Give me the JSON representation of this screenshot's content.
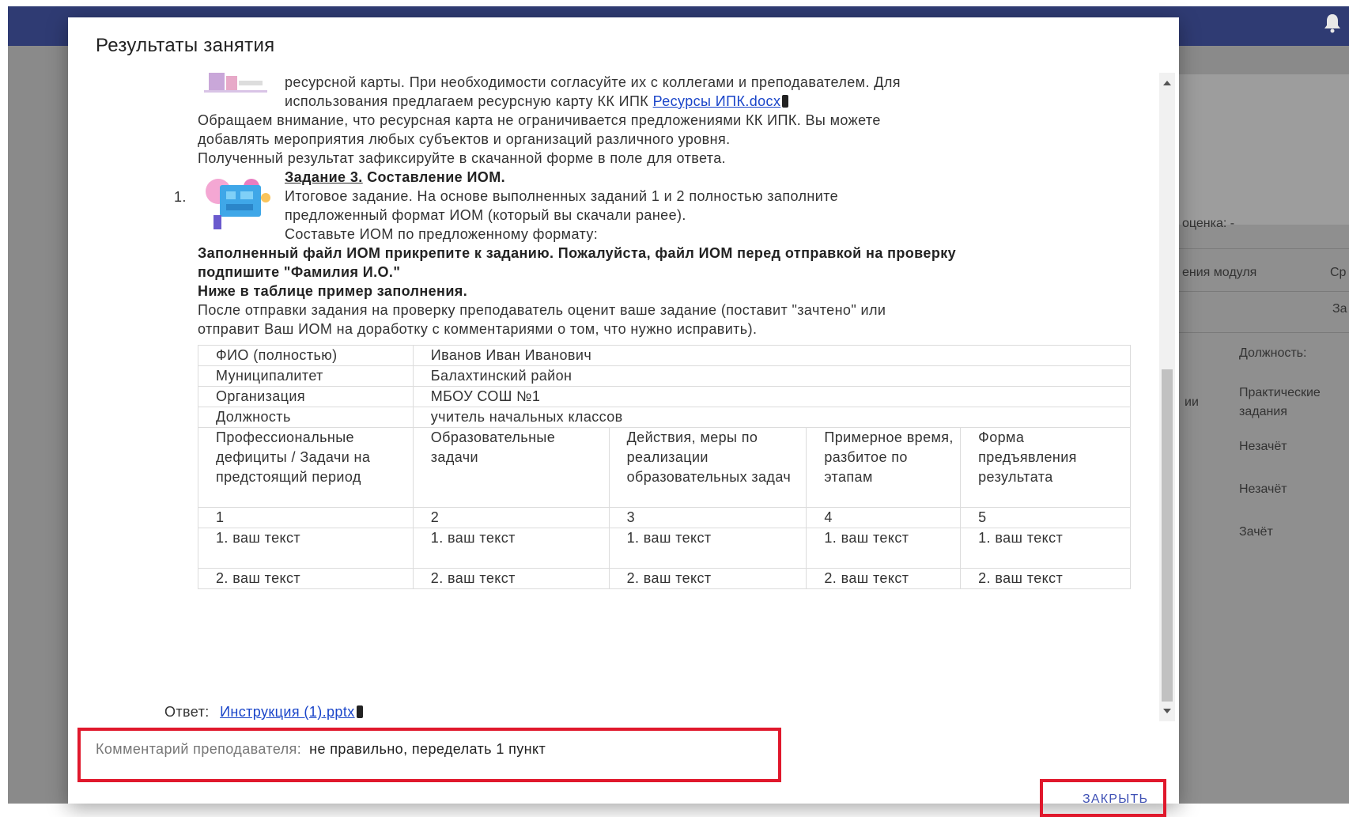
{
  "modal": {
    "title": "Результаты занятия",
    "content": {
      "top_line_1": "ресурсной карты. При необходимости согласуйте их с коллегами и преподавателем. Для",
      "top_line_2_text": "использования предлагаем ресурсную карту КК ИПК ",
      "resource_link": "Ресурсы ИПК.docx",
      "notice_1": "Обращаем внимание, что ресурсная карта не ограничивается предложениями КК ИПК. Вы можете",
      "notice_2": "добавлять мероприятия любых субъектов и организаций различного уровня.",
      "notice_3": "Полученный результат зафиксируйте в скачанной форме в поле для ответа.",
      "list_number": "1.",
      "task_title_underlined": "Задание 3.",
      "task_title_rest": " Составление ИОМ.",
      "task_line_1": "Итоговое задание. На основе выполненных заданий 1 и 2 полностью заполните",
      "task_line_2": "предложенный формат ИОМ (который вы скачали ранее).",
      "task_line_3": "Составьте ИОМ по предложенному формату:",
      "bold_1": "Заполненный файл ИОМ прикрепите к заданию. Пожалуйста, файл ИОМ перед отправкой на проверку",
      "bold_2": "подпишите \"Фамилия И.О.\"",
      "bold_3": "Ниже в таблице пример заполнения.",
      "after_1": "После отправки задания на проверку преподаватель оценит ваше задание (поставит \"зачтено\" или",
      "after_2": "отправит Ваш ИОМ на доработку с комментариями о том, что нужно исправить)."
    },
    "table": {
      "info_rows": [
        [
          "ФИО (полностью)",
          "Иванов Иван Иванович"
        ],
        [
          "Муниципалитет",
          "Балахтинский район"
        ],
        [
          "Организация",
          "МБОУ СОШ №1"
        ],
        [
          "Должность",
          "учитель начальных классов"
        ]
      ],
      "headers": [
        "Профессиональные дефициты / Задачи на предстоящий период",
        "Образовательные задачи",
        "Действия, меры по реализации образовательных задач",
        "Примерное время, разбитое по этапам",
        "Форма предъявления результата"
      ],
      "numbers": [
        "1",
        "2",
        "3",
        "4",
        "5"
      ],
      "row1": [
        "1. ваш текст",
        "1. ваш текст",
        "1. ваш текст",
        "1. ваш текст",
        "1. ваш текст"
      ],
      "row2": [
        "2. ваш текст",
        "2. ваш текст",
        "2. ваш текст",
        "2. ваш текст",
        "2. ваш текст"
      ]
    },
    "answer": {
      "label": "Ответ:",
      "file": "Инструкция (1).pptx"
    },
    "comment": {
      "label": "Комментарий преподавателя:",
      "text": "не правильно, переделать 1 пункт"
    },
    "close_label": "ЗАКРЫТЬ"
  },
  "background": {
    "grade_label": "оценка:  -",
    "col_module": "ения модуля",
    "col_cr": "Ср",
    "col_za": "За",
    "position_label": "Должность:",
    "practical_1": "Практические",
    "practical_2": "задания",
    "fragment_ii": "ии",
    "status_1": "Незачёт",
    "status_2": "Незачёт",
    "status_3": "Зачёт"
  },
  "colors": {
    "topbar": "#2f3b73",
    "highlight": "#e0182c",
    "link": "#1a45c9",
    "close_button": "#3f51b5"
  },
  "icons": [
    "bell-icon",
    "attachment-icon",
    "scroll-up-icon",
    "scroll-down-icon"
  ]
}
